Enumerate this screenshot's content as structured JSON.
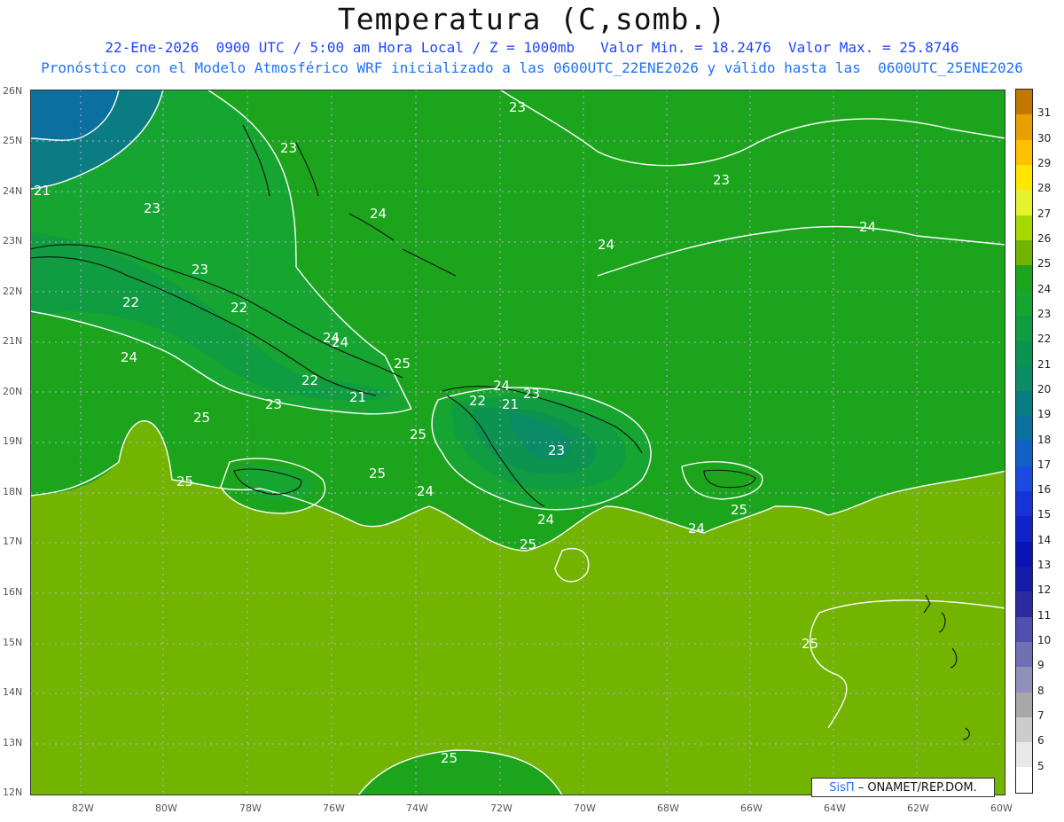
{
  "title": "Temperatura (C,somb.)",
  "subtitle_line1": "22-Ene-2026  0900 UTC / 5:00 am Hora Local / Z = 1000mb   Valor Min. = 18.2476  Valor Max. = 25.8746",
  "subtitle_line2": "Pronóstico con el Modelo Atmosférico WRF inicializado a las 0600UTC_22ENE2026 y válido hasta las  0600UTC_25ENE2026",
  "x_ticks": [
    "82W",
    "80W",
    "78W",
    "76W",
    "74W",
    "72W",
    "70W",
    "68W",
    "66W",
    "64W",
    "62W",
    "60W"
  ],
  "y_ticks": [
    "26N",
    "25N",
    "24N",
    "23N",
    "22N",
    "21N",
    "20N",
    "19N",
    "18N",
    "17N",
    "16N",
    "15N",
    "14N",
    "13N",
    "12N"
  ],
  "colorbar": {
    "labels": [
      "31",
      "30",
      "29",
      "28",
      "27",
      "26",
      "25",
      "24",
      "23",
      "22",
      "21",
      "20",
      "19",
      "18",
      "17",
      "16",
      "15",
      "14",
      "13",
      "12",
      "11",
      "10",
      "9",
      "8",
      "7",
      "6",
      "5"
    ],
    "colors": [
      "#c07800",
      "#e8a000",
      "#ffc000",
      "#ffe600",
      "#e6f230",
      "#a6d800",
      "#73b400",
      "#1ca51c",
      "#16a531",
      "#109c40",
      "#0d9350",
      "#0b8b66",
      "#0b7d82",
      "#0b6fa0",
      "#1060c8",
      "#1a4ae0",
      "#1533d8",
      "#0f23c8",
      "#0a14b4",
      "#161ca8",
      "#2c2ca0",
      "#5050b0",
      "#7070b4",
      "#9090b8",
      "#a8a8a8",
      "#cccccc",
      "#e8e8e8",
      "#ffffff"
    ]
  },
  "contour_labels": [
    "21",
    "23",
    "23",
    "23",
    "24",
    "23",
    "24",
    "24",
    "22",
    "23",
    "22",
    "24",
    "25",
    "22",
    "21",
    "23",
    "24",
    "23",
    "22",
    "21",
    "23",
    "25",
    "25",
    "25",
    "24",
    "25",
    "24",
    "24",
    "25",
    "25",
    "25",
    "24",
    "24",
    "25"
  ],
  "credit": {
    "brand": "SisΠ",
    "org": "– ONAMET/REP.DOM."
  }
}
